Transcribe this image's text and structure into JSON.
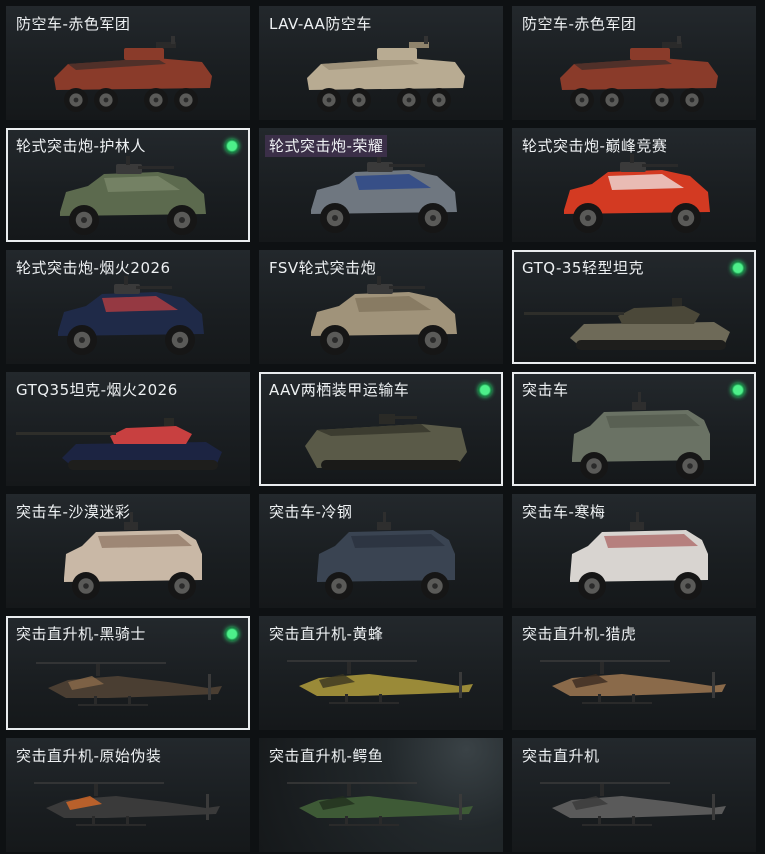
{
  "cards": [
    {
      "name": "防空车-赤色军团",
      "type": "wheeled8",
      "skin": "#8a3b2a",
      "accent": "#2a2a2a",
      "selected": false,
      "owned": false,
      "highlight": false
    },
    {
      "name": "LAV-AA防空车",
      "type": "wheeled8",
      "skin": "#b8ab92",
      "accent": "#8f836c",
      "selected": false,
      "owned": false,
      "highlight": false
    },
    {
      "name": "防空车-赤色军团",
      "type": "wheeled8",
      "skin": "#8a3b2a",
      "accent": "#2a2a2a",
      "selected": false,
      "owned": false,
      "highlight": false
    },
    {
      "name": "轮式突击炮-护林人",
      "type": "armored4",
      "skin": "#5c6a4e",
      "accent": "#7f8c6e",
      "selected": true,
      "owned": true,
      "highlight": false
    },
    {
      "name": "轮式突击炮-荣耀",
      "type": "armored4",
      "skin": "#6f7780",
      "accent": "#1f3f8a",
      "selected": false,
      "owned": false,
      "highlight": true
    },
    {
      "name": "轮式突击炮-巅峰竞赛",
      "type": "armored4",
      "skin": "#d33a22",
      "accent": "#f2f2f2",
      "selected": false,
      "owned": false,
      "highlight": false
    },
    {
      "name": "轮式突击炮-烟火2026",
      "type": "armored4",
      "skin": "#1f2a48",
      "accent": "#c84040",
      "selected": false,
      "owned": false,
      "highlight": false
    },
    {
      "name": "FSV轮式突击炮",
      "type": "armored4",
      "skin": "#a0937a",
      "accent": "#7d705a",
      "selected": false,
      "owned": false,
      "highlight": false
    },
    {
      "name": "GTQ-35轻型坦克",
      "type": "tank",
      "skin": "#6e6a58",
      "accent": "#4b4839",
      "selected": true,
      "owned": true,
      "highlight": false
    },
    {
      "name": "GTQ35坦克-烟火2026",
      "type": "tank",
      "skin": "#1c2442",
      "accent": "#c84040",
      "selected": false,
      "owned": false,
      "highlight": false
    },
    {
      "name": "AAV两栖装甲运输车",
      "type": "aav",
      "skin": "#5a5a48",
      "accent": "#3c3c30",
      "selected": true,
      "owned": true,
      "highlight": false
    },
    {
      "name": "突击车",
      "type": "mrap",
      "skin": "#6a7264",
      "accent": "#4b5246",
      "selected": true,
      "owned": true,
      "highlight": false
    },
    {
      "name": "突击车-沙漠迷彩",
      "type": "mrap",
      "skin": "#c9b8a6",
      "accent": "#7a5e4c",
      "selected": false,
      "owned": false,
      "highlight": false
    },
    {
      "name": "突击车-冷钢",
      "type": "mrap",
      "skin": "#3a4452",
      "accent": "#222a34",
      "selected": false,
      "owned": false,
      "highlight": false
    },
    {
      "name": "突击车-寒梅",
      "type": "mrap",
      "skin": "#d8d4d0",
      "accent": "#9a3a3a",
      "selected": false,
      "owned": false,
      "highlight": false
    },
    {
      "name": "突击直升机-黑骑士",
      "type": "heli",
      "skin": "#4a3e32",
      "accent": "#8a6a4a",
      "selected": true,
      "owned": true,
      "highlight": false
    },
    {
      "name": "突击直升机-黄蜂",
      "type": "heli",
      "skin": "#9a8a38",
      "accent": "#3a3420",
      "selected": false,
      "owned": false,
      "highlight": false
    },
    {
      "name": "突击直升机-猎虎",
      "type": "heli",
      "skin": "#8a6a4a",
      "accent": "#3a2a20",
      "selected": false,
      "owned": false,
      "highlight": false
    },
    {
      "name": "突击直升机-原始伪装",
      "type": "heli",
      "skin": "#3a3a3a",
      "accent": "#d86a28",
      "selected": false,
      "owned": false,
      "highlight": false
    },
    {
      "name": "突击直升机-鳄鱼",
      "type": "heli",
      "skin": "#3e5a36",
      "accent": "#22301e",
      "selected": false,
      "owned": false,
      "highlight": false
    },
    {
      "name": "突击直升机",
      "type": "heli",
      "skin": "#5a5a5a",
      "accent": "#3a3a3a",
      "selected": false,
      "owned": false,
      "highlight": false
    }
  ]
}
